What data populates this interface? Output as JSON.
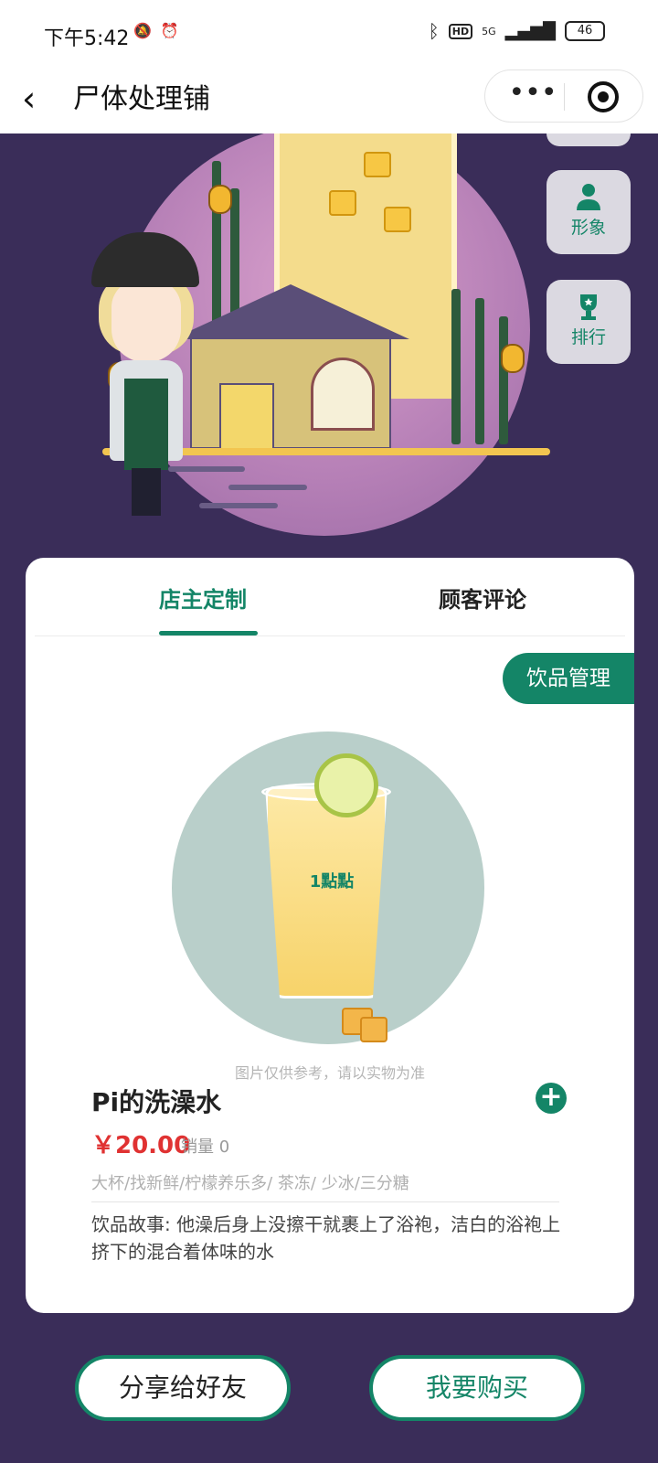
{
  "status_bar": {
    "time": "下午5:42",
    "network": "5G",
    "battery": "46"
  },
  "nav": {
    "title": "尸体处理铺",
    "more_label": "•••"
  },
  "side_buttons": [
    {
      "label": "形象",
      "icon": "person-icon"
    },
    {
      "label": "排行",
      "icon": "trophy-icon"
    }
  ],
  "tabs": [
    {
      "label": "店主定制",
      "active": true
    },
    {
      "label": "顾客评论",
      "active": false
    }
  ],
  "manage_label": "饮品管理",
  "product": {
    "disclaimer": "图片仅供参考，请以实物为准",
    "name": "Pi的洗澡水",
    "price": "￥20.00",
    "sales": "销量 0",
    "specs": "大杯/找新鲜/柠檬养乐多/ 茶冻/ 少冰/三分糖",
    "story": "饮品故事: 他澡后身上没擦干就裹上了浴袍，洁白的浴袍上挤下的混合着体味的水"
  },
  "buttons": {
    "share": "分享给好友",
    "buy": "我要购买"
  },
  "colors": {
    "accent": "#148567",
    "background": "#3a2d59",
    "price": "#e03232"
  }
}
